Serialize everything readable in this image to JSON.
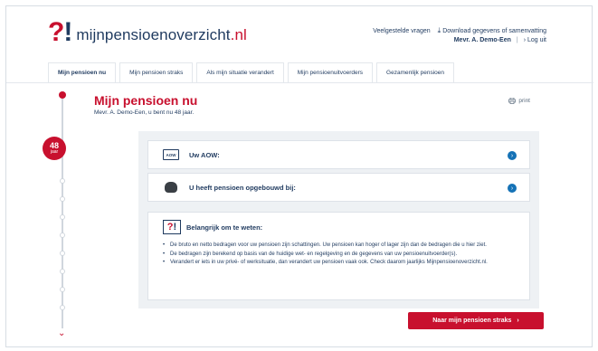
{
  "header": {
    "logo_text_main": "mijnpensioenoverzicht",
    "logo_text_tld": ".nl",
    "links": {
      "faq": "Veelgestelde vragen",
      "download": "Download gegevens of samenvatting"
    },
    "user": {
      "name": "Mevr. A. Demo-Een",
      "separator": "|",
      "logout": "› Log uit"
    }
  },
  "tabs": [
    {
      "label": "Mijn pensioen nu",
      "active": true
    },
    {
      "label": "Mijn pensioen straks",
      "active": false
    },
    {
      "label": "Als mijn situatie verandert",
      "active": false
    },
    {
      "label": "Mijn pensioenuitvoerders",
      "active": false
    },
    {
      "label": "Gezamenlijk pensioen",
      "active": false
    }
  ],
  "timeline": {
    "age_value": "48",
    "age_unit": "jaar",
    "chevron": "⌄"
  },
  "main": {
    "title": "Mijn pensioen nu",
    "subtitle": "Mevr. A. Demo-Een, u bent nu 48 jaar.",
    "print_label": "print"
  },
  "cards": {
    "aow": {
      "icon_text": "AOW",
      "label": "Uw AOW:"
    },
    "pension": {
      "label": "U heeft pensioen opgebouwd bij:"
    }
  },
  "notice": {
    "title": "Belangrijk om te weten:",
    "items": [
      "De bruto en netto bedragen voor uw pensioen zijn schattingen. Uw pensioen kan hoger of lager zijn dan de bedragen die u hier ziet.",
      "De bedragen zijn berekend op basis van de huidige wet- en regelgeving en de gegevens van uw pensioenuitvoerder(s).",
      "Verandert er iets in uw privé- of werksituatie, dan verandert uw pensioen vaak ook. Check daarom jaarlijks Mijnpensioenoverzicht.nl."
    ]
  },
  "footer": {
    "next_button_label": "Naar mijn pensioen straks",
    "next_button_arrow": "›"
  },
  "colors": {
    "brand_red": "#c8102e",
    "navy": "#1f3a5f",
    "info_blue": "#1572b6",
    "panel_bg": "#eef1f4"
  }
}
